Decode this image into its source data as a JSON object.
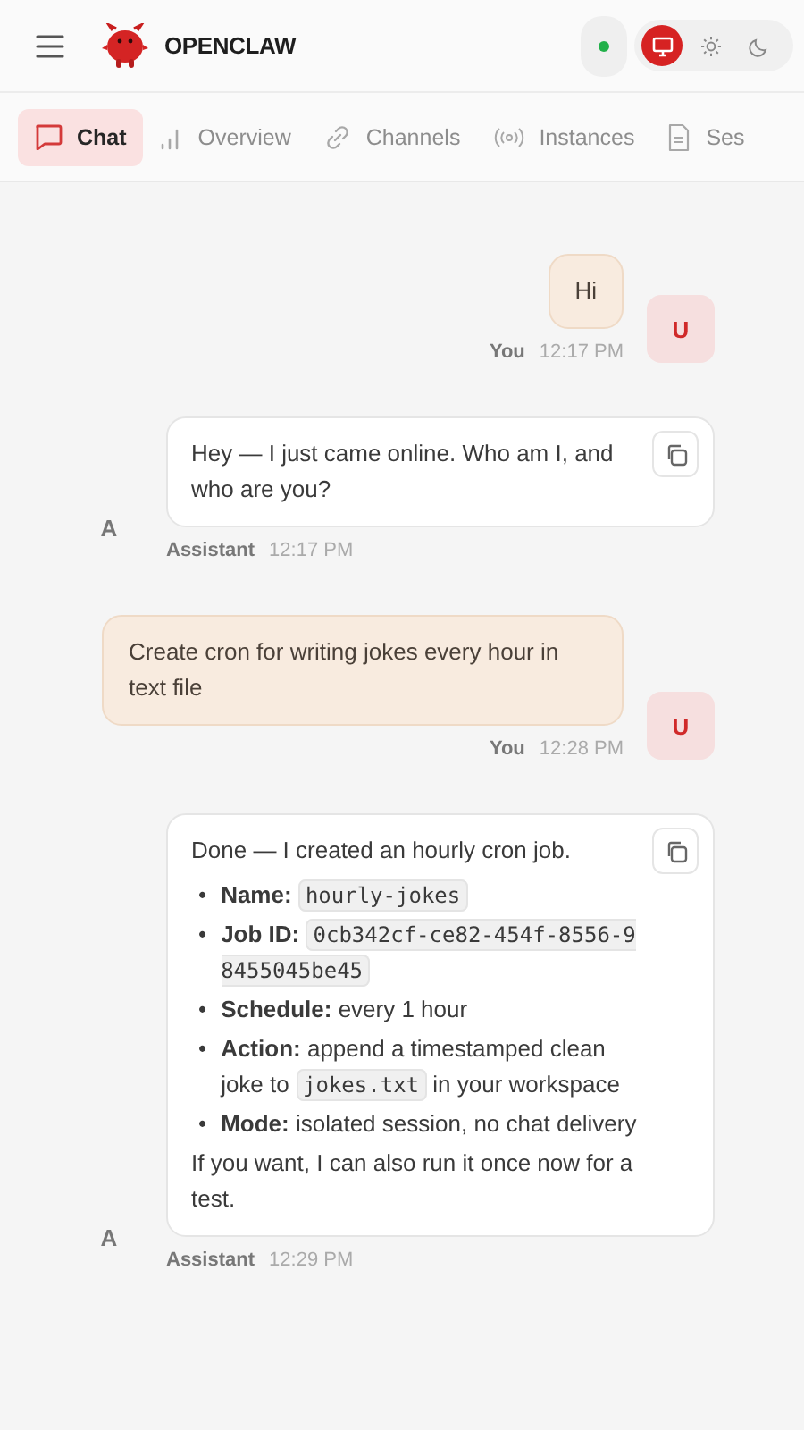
{
  "header": {
    "title": "OPENCLAW",
    "connected": true,
    "theme_options": [
      {
        "kind": "system",
        "selected": true
      },
      {
        "kind": "light",
        "selected": false
      },
      {
        "kind": "dark",
        "selected": false
      }
    ]
  },
  "tabs": [
    {
      "kind": "chat",
      "label": "Chat",
      "selected": true
    },
    {
      "kind": "overview",
      "label": "Overview",
      "selected": false
    },
    {
      "kind": "channels",
      "label": "Channels",
      "selected": false
    },
    {
      "kind": "instances",
      "label": "Instances",
      "selected": false
    },
    {
      "kind": "sessions",
      "label": "Ses",
      "selected": false
    }
  ],
  "messages": [
    {
      "kind": "user",
      "avatar": "U",
      "sender": "You",
      "time": "12:17 PM",
      "text": "Hi"
    },
    {
      "kind": "assistant",
      "avatar": "A",
      "sender": "Assistant",
      "time": "12:17 PM",
      "text": "Hey — I just came online. Who am I, and who are you?"
    },
    {
      "kind": "user",
      "avatar": "U",
      "sender": "You",
      "time": "12:28 PM",
      "text": "Create cron for writing jokes every hour in text file"
    },
    {
      "kind": "assistant",
      "avatar": "A",
      "sender": "Assistant",
      "time": "12:29 PM",
      "text": "Done — I created an hourly cron job.",
      "bullet_marker": "•",
      "bullets": [
        {
          "label": "Name:",
          "segments": [
            {
              "kind": "code",
              "text": "hourly-jokes"
            }
          ]
        },
        {
          "label": "Job ID:",
          "segments": [
            {
              "kind": "code",
              "text": "0cb342cf-ce82-454f-8556-98455045be45"
            }
          ]
        },
        {
          "label": "Schedule:",
          "segments": [
            {
              "kind": "text",
              "text": "every 1 hour"
            }
          ]
        },
        {
          "label": "Action:",
          "segments": [
            {
              "kind": "text",
              "text": "append a timestamped clean joke to"
            },
            {
              "kind": "code",
              "text": "jokes.txt"
            },
            {
              "kind": "text",
              "text": "in your workspace"
            }
          ]
        },
        {
          "label": "Mode:",
          "segments": [
            {
              "kind": "text",
              "text": "isolated session, no chat delivery"
            }
          ]
        }
      ],
      "outro": "If you want, I can also run it once now for a test."
    }
  ]
}
